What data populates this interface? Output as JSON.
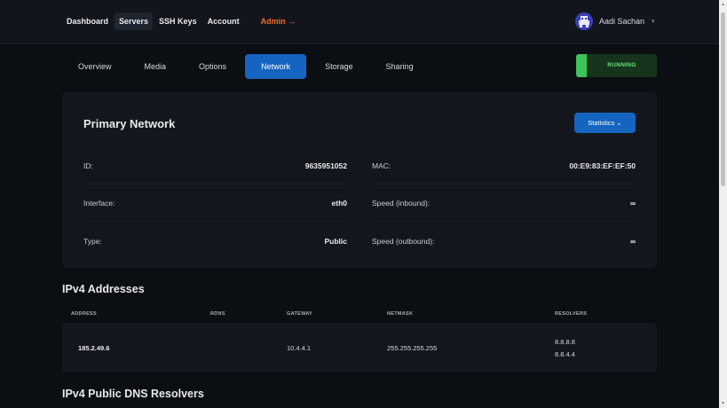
{
  "nav": {
    "items": [
      "Dashboard",
      "Servers",
      "SSH Keys",
      "Account"
    ],
    "admin": "Admin →",
    "user_name": "Aadi Sachan",
    "user_caret": "▾"
  },
  "tabs": [
    "Overview",
    "Media",
    "Options",
    "Network",
    "Storage",
    "Sharing"
  ],
  "active_tab": "Network",
  "status": {
    "label": "RUNNING",
    "color": "#3ec25a"
  },
  "network": {
    "title": "Primary Network",
    "stats_button": "Statistics ⌄",
    "fields": {
      "id_label": "ID:",
      "id_value": "9635951052",
      "mac_label": "MAC:",
      "mac_value": "00:E9:83:EF:EF:50",
      "interface_label": "Interface:",
      "interface_value": "eth0",
      "speed_in_label": "Speed (inbound):",
      "speed_in_value": "∞",
      "type_label": "Type:",
      "type_value": "Public",
      "speed_out_label": "Speed (outbound):",
      "speed_out_value": "∞"
    }
  },
  "ipv4": {
    "title": "IPv4 Addresses",
    "headers": [
      "ADDRESS",
      "RDNS",
      "GATEWAY",
      "NETMASK",
      "RESOLVERS"
    ],
    "rows": [
      {
        "address": "185.2.49.6",
        "rdns": "",
        "gateway": "10.4.4.1",
        "netmask": "255.255.255.255",
        "resolver1": "8.8.8.8",
        "resolver2": "8.8.4.4"
      }
    ]
  },
  "dns": {
    "title": "IPv4 Public DNS Resolvers"
  },
  "colors": {
    "accent": "#1565c0",
    "admin": "#f06a2a",
    "background": "#0b0e13",
    "panel": "#13171d"
  }
}
